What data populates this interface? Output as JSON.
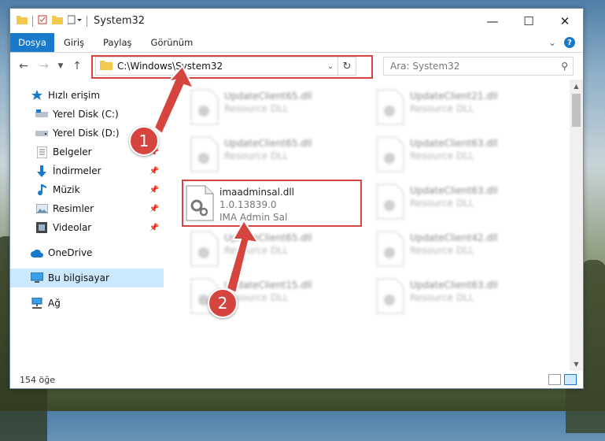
{
  "window": {
    "title": "System32"
  },
  "ribbon": {
    "tabs": [
      "Dosya",
      "Giriş",
      "Paylaş",
      "Görünüm"
    ]
  },
  "address": {
    "path": "C:\\Windows\\System32"
  },
  "search": {
    "placeholder": "Ara: System32"
  },
  "sidebar": {
    "items": [
      {
        "label": "Hızlı erişim",
        "icon": "star-icon"
      },
      {
        "label": "Yerel Disk (C:)",
        "icon": "drive-icon"
      },
      {
        "label": "Yerel Disk (D:)",
        "icon": "drive-icon"
      },
      {
        "label": "Belgeler",
        "icon": "documents-icon"
      },
      {
        "label": "İndirmeler",
        "icon": "download-icon"
      },
      {
        "label": "Müzik",
        "icon": "music-icon"
      },
      {
        "label": "Resimler",
        "icon": "pictures-icon"
      },
      {
        "label": "Videolar",
        "icon": "video-icon"
      },
      {
        "label": "OneDrive",
        "icon": "cloud-icon"
      },
      {
        "label": "Bu bilgisayar",
        "icon": "computer-icon"
      },
      {
        "label": "Ağ",
        "icon": "network-icon"
      }
    ]
  },
  "files": {
    "highlighted": {
      "name": "imaadminsal.dll",
      "version": "1.0.13839.0",
      "description": "IMA Admin Sal"
    },
    "items": [
      {
        "name": "UpdateClient65.dll",
        "type": "Resource DLL"
      },
      {
        "name": "UpdateClient21.dll",
        "type": "Resource DLL"
      },
      {
        "name": "UpdateClient65.dll",
        "type": "Resource DLL"
      },
      {
        "name": "UpdateClient63.dll",
        "type": "Resource DLL"
      },
      {
        "name": "UpdateClient63.dll",
        "type": "Resource DLL"
      },
      {
        "name": "UpdateClient65.dll",
        "type": "Resource DLL"
      },
      {
        "name": "UpdateClient42.dll",
        "type": "Resource DLL"
      },
      {
        "name": "UpdateClient15.dll",
        "type": "Resource DLL"
      },
      {
        "name": "UpdateClient63.dll",
        "type": "Resource DLL"
      }
    ]
  },
  "status": {
    "count": "154 öğe"
  },
  "annotations": {
    "step1": "1",
    "step2": "2"
  },
  "colors": {
    "accent": "#1979ca",
    "highlight": "#d5443e",
    "selected": "#cce8ff"
  }
}
